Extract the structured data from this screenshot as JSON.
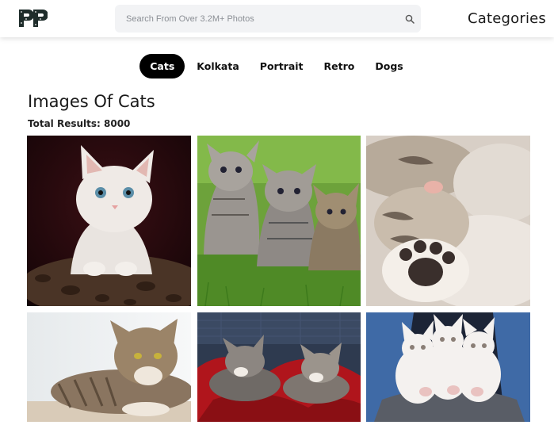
{
  "header": {
    "logo_text": "PP",
    "search_placeholder": "Search From Over 3.2M+ Photos",
    "search_value": "",
    "categories_label": "Categories"
  },
  "tabs": [
    {
      "label": "Cats",
      "active": true
    },
    {
      "label": "Kolkata",
      "active": false
    },
    {
      "label": "Portrait",
      "active": false
    },
    {
      "label": "Retro",
      "active": false
    },
    {
      "label": "Dogs",
      "active": false
    }
  ],
  "main": {
    "title": "Images Of Cats",
    "total_results": "Total Results: 8000"
  },
  "photos": [
    {
      "subject": "white kitten on leopard-print bed"
    },
    {
      "subject": "three tabby kittens on grass"
    },
    {
      "subject": "sleeping kittens close-up with paw"
    },
    {
      "subject": "tabby cat lying down"
    },
    {
      "subject": "two kittens sleeping on red blanket"
    },
    {
      "subject": "three white fluffy kittens held by person"
    }
  ],
  "colors": {
    "accent": "#000000",
    "search_bg": "#f2f3f5",
    "logo_dark": "#1f2d2b"
  }
}
